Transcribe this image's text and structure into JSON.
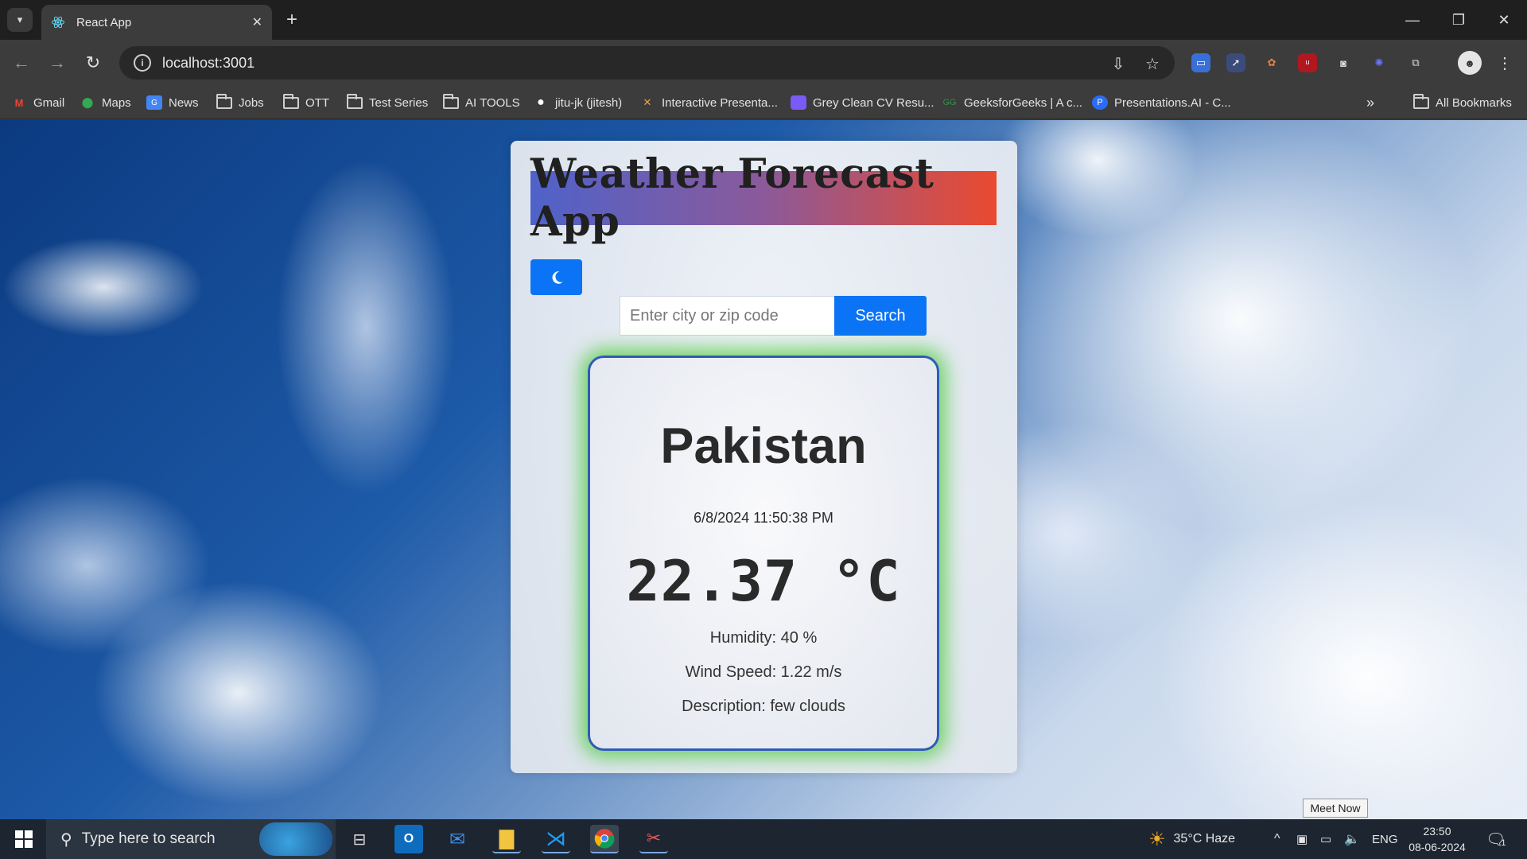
{
  "browser": {
    "tab_title": "React App",
    "url": "localhost:3001",
    "bookmarks": [
      {
        "label": "Gmail",
        "icon": "gmail-icon"
      },
      {
        "label": "Maps",
        "icon": "maps-icon"
      },
      {
        "label": "News",
        "icon": "news-icon"
      },
      {
        "label": "Jobs",
        "icon": "folder-icon"
      },
      {
        "label": "OTT",
        "icon": "folder-icon"
      },
      {
        "label": "Test Series",
        "icon": "folder-icon"
      },
      {
        "label": "AI TOOLS",
        "icon": "folder-icon"
      },
      {
        "label": "jitu-jk (jitesh)",
        "icon": "github-icon"
      },
      {
        "label": "Interactive Presenta...",
        "icon": "presentation-icon"
      },
      {
        "label": "Grey Clean CV Resu...",
        "icon": "canva-icon"
      },
      {
        "label": "GeeksforGeeks | A c...",
        "icon": "gfg-icon"
      },
      {
        "label": "Presentations.AI - C...",
        "icon": "presentations-ai-icon"
      }
    ],
    "all_bookmarks": "All Bookmarks",
    "accent": "#3c3c3c"
  },
  "app": {
    "title": "Weather Forecast App",
    "search_placeholder": "Enter city or zip code",
    "search_button": "Search",
    "theme_icon": "moon-icon",
    "primary_color": "#0b74f6"
  },
  "weather": {
    "city": "Pakistan",
    "datetime": "6/8/2024 11:50:38 PM",
    "temperature": "22.37 °C",
    "humidity": "Humidity: 40 %",
    "wind": "Wind Speed: 1.22 m/s",
    "description": "Description: few clouds",
    "glow_color": "#3cc828"
  },
  "taskbar": {
    "search_placeholder": "Type here to search",
    "weather": "35°C  Haze",
    "language": "ENG",
    "time": "23:50",
    "date": "08-06-2024",
    "notifications": "1",
    "meet_now": "Meet Now"
  }
}
